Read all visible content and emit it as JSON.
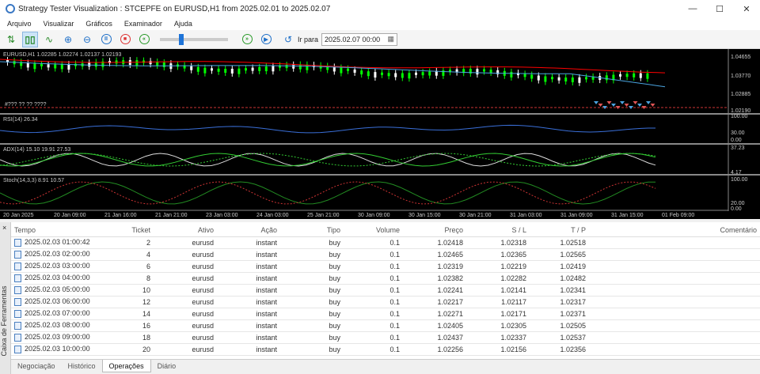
{
  "window": {
    "title": "Strategy Tester Visualization : STCEPFE on EURUSD,H1 from 2025.02.01 to 2025.02.07"
  },
  "menu": [
    "Arquivo",
    "Visualizar",
    "Gráficos",
    "Examinador",
    "Ajuda"
  ],
  "toolbar": {
    "goto_label": "Ir para",
    "goto_date": "2025.02.07 00:00",
    "speed_fraction": 0.3
  },
  "chart": {
    "symbol_info": "EURUSD,H1  1.02285 1.02274 1.02137 1.02193",
    "trade_label": "#??? ?? ?? ????",
    "price_scale": [
      "1.04655",
      "1.03770",
      "1.02885",
      "1.02190"
    ],
    "rsi_label": "RSI(14) 26.34",
    "rsi_scale": [
      "100.00",
      "30.00",
      "0.00"
    ],
    "adx_label": "ADX(14) 15.10 19.91 27.53",
    "adx_scale": [
      "37.23",
      "4.17"
    ],
    "stoch_label": "Stoch(14,3,3) 8.91 10.57",
    "stoch_scale": [
      "100.00",
      "20.00",
      "0.00"
    ],
    "time_axis": [
      "20 Jan 2025",
      "20 Jan 09:00",
      "21 Jan 16:00",
      "21 Jan 21:00",
      "23 Jan 03:00",
      "24 Jan 03:00",
      "25 Jan 21:00",
      "30 Jan 09:00",
      "30 Jan 15:00",
      "30 Jan 21:00",
      "31 Jan 03:00",
      "31 Jan 09:00",
      "31 Jan 15:00",
      "01 Feb 09:00"
    ],
    "colors": {
      "bg": "#000000",
      "up": "#ffffff",
      "down": "#00ff00",
      "ma1": "#ff0000",
      "ma2": "#4aa3df",
      "rsi": "#3a6fd8",
      "adx": "#33cc33",
      "stoch": "#228b22"
    }
  },
  "table": {
    "headers": [
      "Tempo",
      "Ticket",
      "Ativo",
      "Ação",
      "Tipo",
      "Volume",
      "Preço",
      "S / L",
      "T / P",
      "Comentário"
    ],
    "rows": [
      [
        "2025.02.03 01:00:42",
        "2",
        "eurusd",
        "instant",
        "buy",
        "0.1",
        "1.02418",
        "1.02318",
        "1.02518",
        ""
      ],
      [
        "2025.02.03 02:00:00",
        "4",
        "eurusd",
        "instant",
        "buy",
        "0.1",
        "1.02465",
        "1.02365",
        "1.02565",
        ""
      ],
      [
        "2025.02.03 03:00:00",
        "6",
        "eurusd",
        "instant",
        "buy",
        "0.1",
        "1.02319",
        "1.02219",
        "1.02419",
        ""
      ],
      [
        "2025.02.03 04:00:00",
        "8",
        "eurusd",
        "instant",
        "buy",
        "0.1",
        "1.02382",
        "1.02282",
        "1.02482",
        ""
      ],
      [
        "2025.02.03 05:00:00",
        "10",
        "eurusd",
        "instant",
        "buy",
        "0.1",
        "1.02241",
        "1.02141",
        "1.02341",
        ""
      ],
      [
        "2025.02.03 06:00:00",
        "12",
        "eurusd",
        "instant",
        "buy",
        "0.1",
        "1.02217",
        "1.02117",
        "1.02317",
        ""
      ],
      [
        "2025.02.03 07:00:00",
        "14",
        "eurusd",
        "instant",
        "buy",
        "0.1",
        "1.02271",
        "1.02171",
        "1.02371",
        ""
      ],
      [
        "2025.02.03 08:00:00",
        "16",
        "eurusd",
        "instant",
        "buy",
        "0.1",
        "1.02405",
        "1.02305",
        "1.02505",
        ""
      ],
      [
        "2025.02.03 09:00:00",
        "18",
        "eurusd",
        "instant",
        "buy",
        "0.1",
        "1.02437",
        "1.02337",
        "1.02537",
        ""
      ],
      [
        "2025.02.03 10:00:00",
        "20",
        "eurusd",
        "instant",
        "buy",
        "0.1",
        "1.02256",
        "1.02156",
        "1.02356",
        ""
      ]
    ]
  },
  "toolbox": {
    "side_label": "Caixa de Ferramentas",
    "close": "×"
  },
  "tabs": [
    "Negociação",
    "Histórico",
    "Operações",
    "Diário"
  ],
  "active_tab": 2
}
